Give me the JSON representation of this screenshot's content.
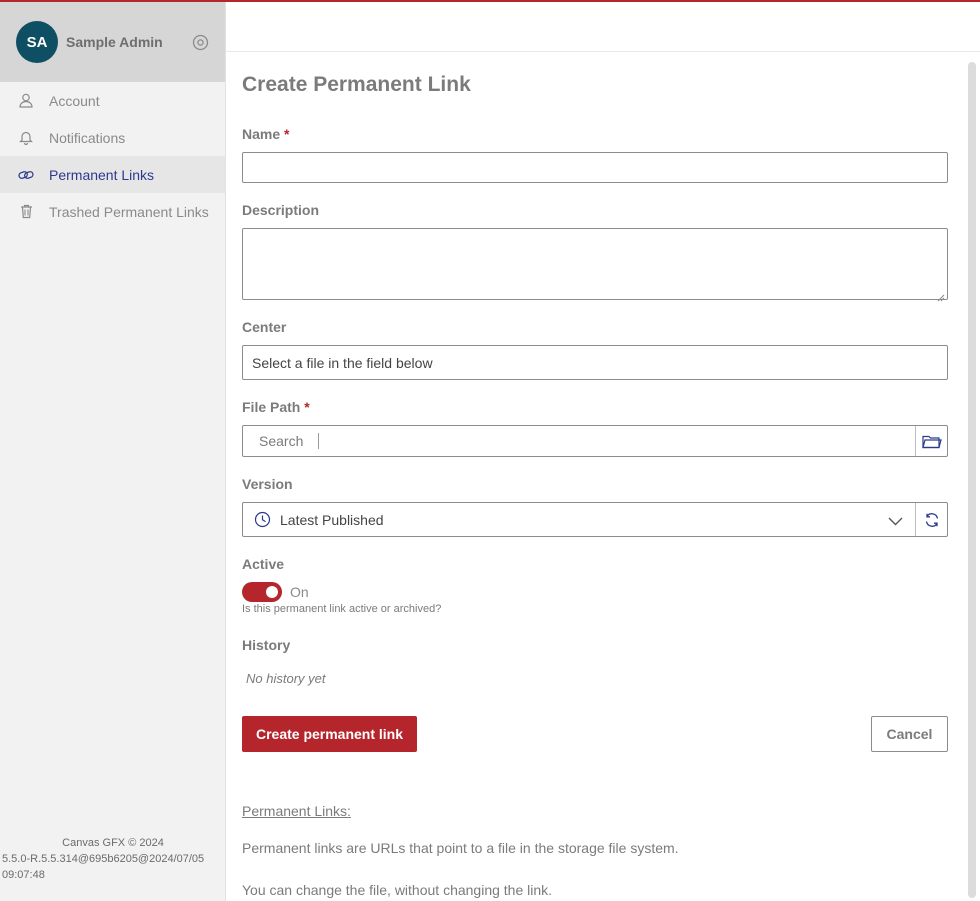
{
  "user": {
    "initials": "SA",
    "name": "Sample Admin"
  },
  "sidebar": {
    "items": [
      {
        "label": "Account",
        "icon": "user-icon"
      },
      {
        "label": "Notifications",
        "icon": "bell-icon"
      },
      {
        "label": "Permanent Links",
        "icon": "link-icon",
        "active": true
      },
      {
        "label": "Trashed Permanent Links",
        "icon": "trash-icon"
      }
    ],
    "footer": {
      "copyright": "Canvas GFX © 2024",
      "version": "5.5.0-R.5.5.314@695b6205@2024/07/05",
      "time": "09:07:48"
    }
  },
  "form": {
    "title": "Create Permanent Link",
    "name_label": "Name",
    "required_mark": "*",
    "name_value": "",
    "description_label": "Description",
    "center_label": "Center",
    "center_value": "Select a file in the field below",
    "file_path_label": "File Path",
    "file_path_search": "Search",
    "version_label": "Version",
    "version_value": "Latest Published",
    "active_label": "Active",
    "active_state": "On",
    "active_hint": "Is this permanent link active or archived?",
    "history_label": "History",
    "history_empty": "No history yet",
    "create_button": "Create permanent link",
    "cancel_button": "Cancel"
  },
  "info": {
    "title": "Permanent Links:",
    "line1": "Permanent links are URLs that point to a file in the storage file system.",
    "line2": "You can change the file, without changing the link."
  },
  "colors": {
    "accent": "#b5262c",
    "avatar": "#0f4f63",
    "active_nav": "#2b3a8f"
  }
}
